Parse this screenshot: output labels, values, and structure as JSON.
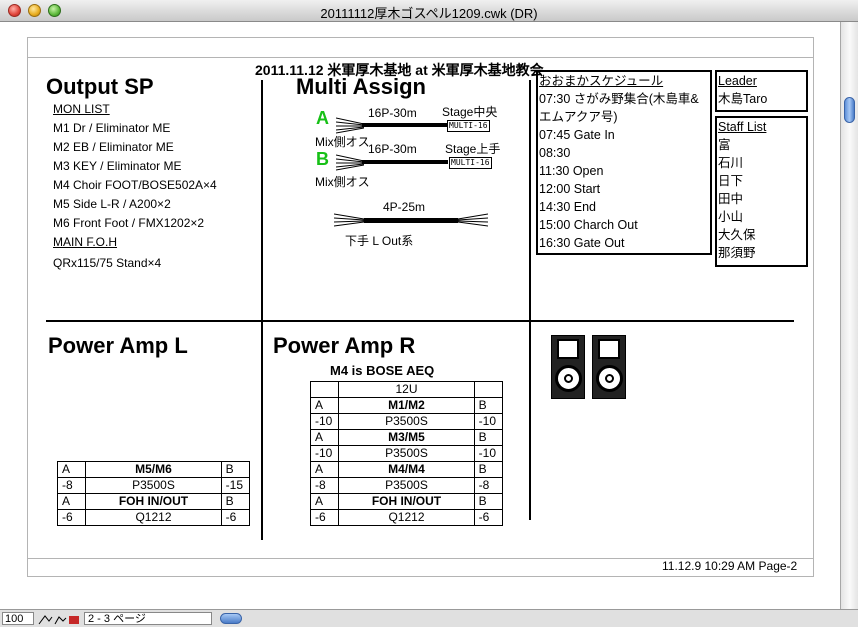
{
  "window": {
    "title": "20111112厚木ゴスペル1209.cwk (DR)"
  },
  "doc_title": "2011.11.12 米軍厚木基地 at 米軍厚木基地教会",
  "output_sp": {
    "heading": "Output SP",
    "mon_label": "MON LIST",
    "mon_items": [
      "M1 Dr / Eliminator ME",
      "M2 EB / Eliminator ME",
      "M3 KEY / Eliminator ME",
      "M4 Choir FOOT/BOSE502A×4",
      "M5 Side L-R / A200×2",
      "M6 Front Foot / FMX1202×2"
    ],
    "foh_label": "MAIN F.O.H",
    "foh_item": "QRx115/75  Stand×4"
  },
  "multi_assign": {
    "heading": "Multi Assign",
    "a": {
      "letter": "A",
      "cable": "16P-30m",
      "stage": "Stage中央",
      "tag": "MULTI-16",
      "mix": "Mix側オス"
    },
    "b": {
      "letter": "B",
      "cable": "16P-30m",
      "stage": "Stage上手",
      "tag": "MULTI-16",
      "mix": "Mix側オス"
    },
    "c": {
      "cable": "4P-25m",
      "label": "下手 L Out系"
    }
  },
  "schedule": {
    "title": "おおまかスケジュール",
    "items": [
      "07:30 さがみ野集合(木島車&",
      "エムアクア号)",
      "07:45 Gate In",
      "08:30",
      "11:30 Open",
      "12:00 Start",
      "14:30 End",
      "15:00 Charch Out",
      "16:30 Gate Out"
    ]
  },
  "leader": {
    "label": "Leader",
    "name": "木島Taro"
  },
  "staff": {
    "label": "Staff List",
    "names": [
      "富",
      "石川",
      "日下",
      "田中",
      "小山",
      "大久保",
      "那須野"
    ]
  },
  "power_amp_l": {
    "heading": "Power Amp L",
    "rows": [
      [
        "A",
        "M5/M6",
        "B"
      ],
      [
        "-8",
        "P3500S",
        "-15"
      ],
      [
        "A",
        "FOH IN/OUT",
        "B"
      ],
      [
        "-6",
        "Q1212",
        "-6"
      ]
    ]
  },
  "power_amp_r": {
    "heading": "Power Amp R",
    "sub": "M4 is BOSE AEQ",
    "rack": "12U",
    "rows": [
      [
        "A",
        "M1/M2",
        "B"
      ],
      [
        "-10",
        "P3500S",
        "-10"
      ],
      [
        "A",
        "M3/M5",
        "B"
      ],
      [
        "-10",
        "P3500S",
        "-10"
      ],
      [
        "A",
        "M4/M4",
        "B"
      ],
      [
        "-8",
        "P3500S",
        "-8"
      ],
      [
        "A",
        "FOH IN/OUT",
        "B"
      ],
      [
        "-6",
        "Q1212",
        "-6"
      ]
    ]
  },
  "footer": "11.12.9 10:29 AM Page-2",
  "status": {
    "zoom": "100",
    "page": "2 - 3 ページ"
  }
}
